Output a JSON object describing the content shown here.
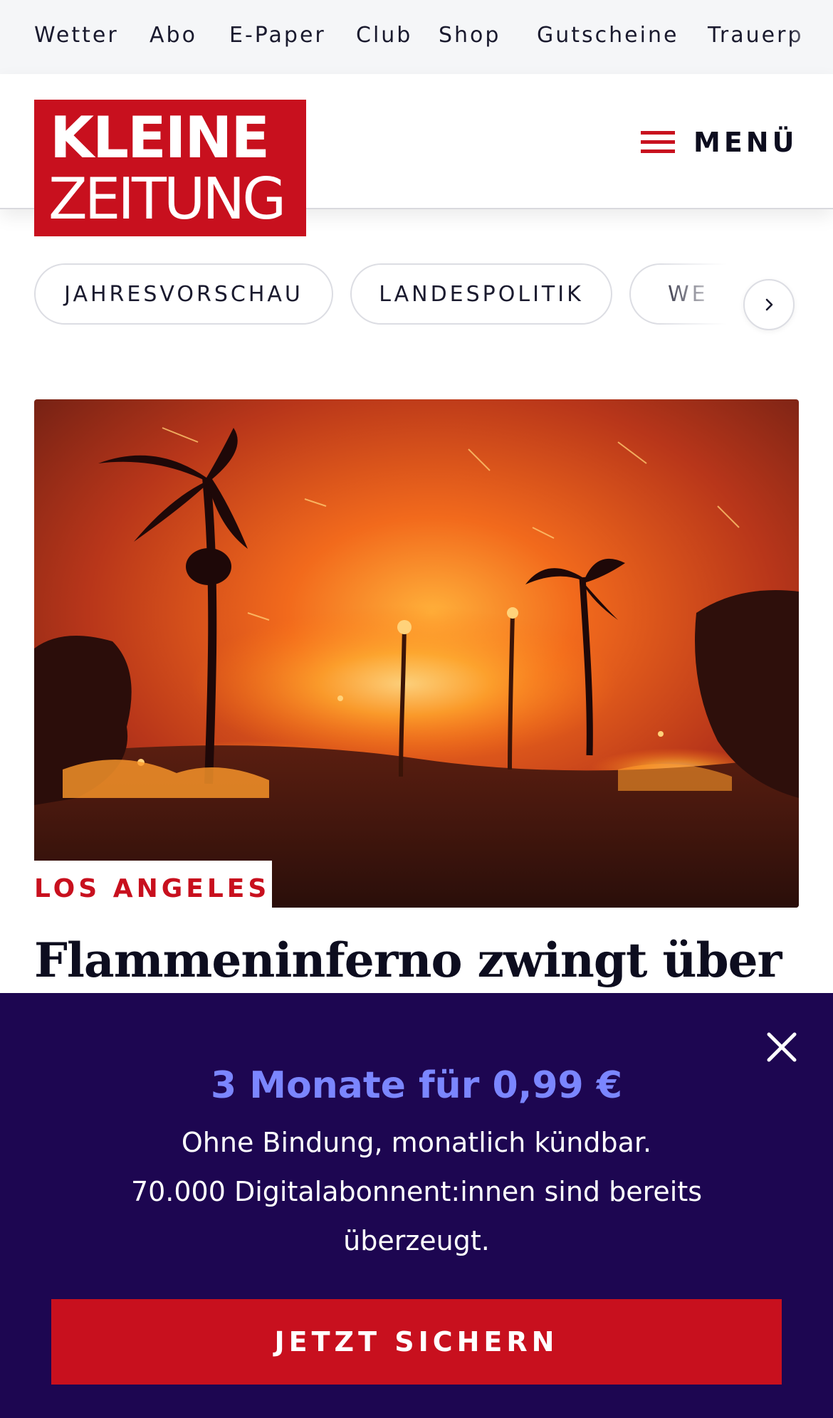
{
  "topnav": {
    "items": [
      {
        "label": "Wetter"
      },
      {
        "label": "Abo"
      },
      {
        "label": "E-Paper"
      },
      {
        "label": "Club"
      },
      {
        "label": "Shop"
      },
      {
        "label": "Gutscheine"
      },
      {
        "label": "Trauerp"
      }
    ]
  },
  "header": {
    "logo_line1": "KLEINE",
    "logo_line2": "ZEITUNG",
    "menu_label": "MENÜ",
    "menu_icon": "hamburger-icon"
  },
  "topics": {
    "pills": [
      {
        "label": "JAHRESVORSCHAU"
      },
      {
        "label": "LANDESPOLITIK"
      },
      {
        "label": "WE"
      }
    ],
    "next_icon": "chevron-right-icon"
  },
  "article": {
    "kicker": "LOS ANGELES",
    "headline": "Flammeninferno zwingt über"
  },
  "promo": {
    "title": "3 Monate für 0,99 €",
    "line1": "Ohne Bindung, monatlich kündbar.",
    "line2": "70.000 Digitalabonnent:innen sind bereits überzeugt.",
    "cta": "JETZT SICHERN",
    "close_icon": "close-icon"
  },
  "colors": {
    "brand_red": "#c8101e",
    "promo_bg": "#1d0651",
    "promo_accent": "#7b86ff"
  }
}
